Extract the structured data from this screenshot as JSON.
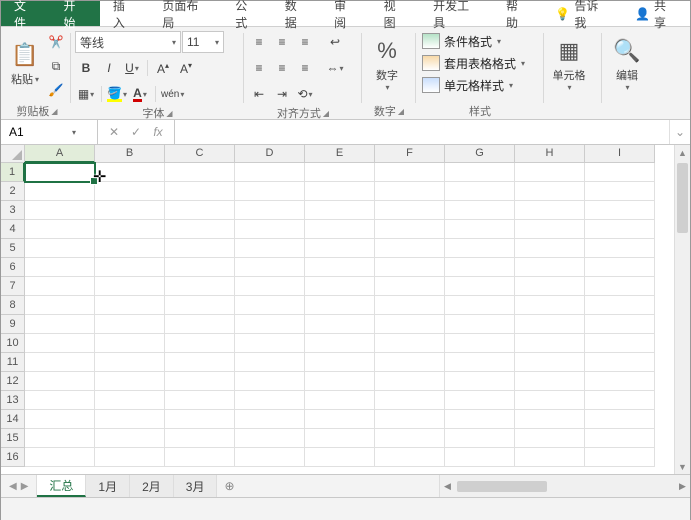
{
  "tabs": {
    "file": "文件",
    "home": "开始",
    "insert": "插入",
    "layout": "页面布局",
    "formulas": "公式",
    "data": "数据",
    "review": "审阅",
    "view": "视图",
    "dev": "开发工具",
    "help": "帮助",
    "tell": "告诉我",
    "share": "共享"
  },
  "ribbon": {
    "clipboard": {
      "paste": "粘贴",
      "label": "剪贴板"
    },
    "font": {
      "family": "等线",
      "size": "11",
      "label": "字体",
      "bold": "B",
      "italic": "I",
      "underline": "U",
      "phonetic": "wén"
    },
    "align": {
      "label": "对齐方式"
    },
    "number": {
      "btn": "数字",
      "label": "数字",
      "pct": "%"
    },
    "styles": {
      "cond": "条件格式",
      "table": "套用表格格式",
      "cell": "单元格样式",
      "label": "样式"
    },
    "cells": {
      "btn": "单元格"
    },
    "editing": {
      "btn": "编辑"
    }
  },
  "fbar": {
    "ref": "A1",
    "fx": "fx"
  },
  "grid": {
    "cols": [
      "A",
      "B",
      "C",
      "D",
      "E",
      "F",
      "G",
      "H",
      "I"
    ],
    "rows": [
      "1",
      "2",
      "3",
      "4",
      "5",
      "6",
      "7",
      "8",
      "9",
      "10",
      "11",
      "12",
      "13",
      "14",
      "15",
      "16"
    ],
    "active_col": 0,
    "active_row": 0
  },
  "sheets": {
    "tabs": [
      "汇总",
      "1月",
      "2月",
      "3月"
    ],
    "active": 0
  }
}
